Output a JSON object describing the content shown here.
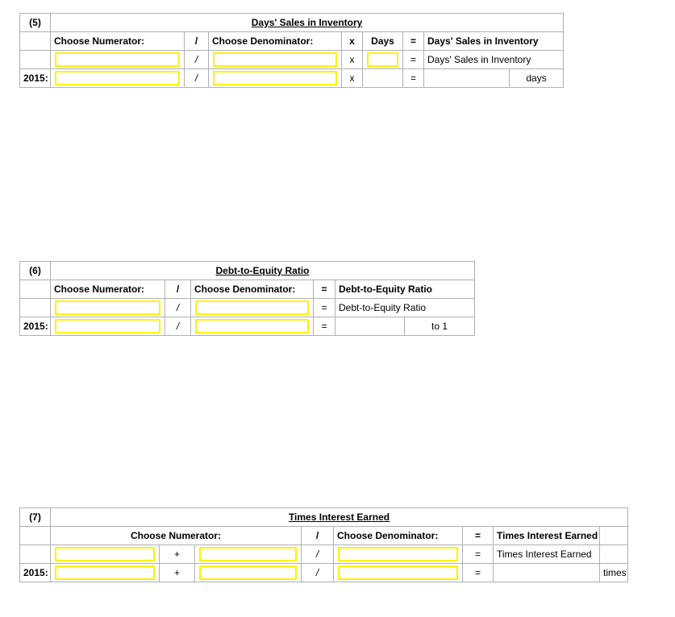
{
  "colors": {
    "header_blue": "#8ca9d9",
    "input_yellow": "#fff200",
    "gridline": "#b0b0b0",
    "text": "#1a1a1a"
  },
  "labels": {
    "choose_numerator": "Choose Numerator:",
    "choose_denominator": "Choose Denominator:",
    "year": "2015:",
    "slash": "/",
    "times": "x",
    "equals": "=",
    "plus": "+"
  },
  "tables": [
    {
      "index": "(5)",
      "title": "Days' Sales in Inventory",
      "headers": {
        "numerator": "Choose Numerator:",
        "op1": "/",
        "denominator": "Choose Denominator:",
        "op2": "x",
        "days": "Days",
        "op3": "=",
        "result": "Days' Sales in Inventory"
      },
      "row1": {
        "label": "",
        "numerator": "",
        "op1": "/",
        "denominator": "",
        "op2": "x",
        "days": "",
        "op3": "=",
        "result": "Days' Sales in Inventory"
      },
      "row2": {
        "label": "2015:",
        "numerator": "",
        "op1": "/",
        "denominator": "",
        "op2": "x",
        "days": "",
        "op3": "=",
        "result_value": "",
        "result_unit": "days"
      }
    },
    {
      "index": "(6)",
      "title": "Debt-to-Equity Ratio",
      "headers": {
        "numerator": "Choose Numerator:",
        "op1": "/",
        "denominator": "Choose Denominator:",
        "op2": "=",
        "result": "Debt-to-Equity Ratio"
      },
      "row1": {
        "label": "",
        "numerator": "",
        "op1": "/",
        "denominator": "",
        "op2": "=",
        "result": "Debt-to-Equity Ratio"
      },
      "row2": {
        "label": "2015:",
        "numerator": "",
        "op1": "/",
        "denominator": "",
        "op2": "=",
        "result_value": "",
        "result_unit": "to 1"
      }
    },
    {
      "index": "(7)",
      "title": "Times Interest Earned",
      "headers": {
        "numerator": "Choose Numerator:",
        "op1": "/",
        "denominator": "Choose Denominator:",
        "op2": "=",
        "result": "Times Interest Earned",
        "unit": ""
      },
      "row1": {
        "label": "",
        "numerator_a": "",
        "plus": "+",
        "numerator_b": "",
        "op1": "/",
        "denominator": "",
        "op2": "=",
        "result": "Times Interest Earned",
        "unit": ""
      },
      "row2": {
        "label": "2015:",
        "numerator_a": "",
        "plus": "+",
        "numerator_b": "",
        "op1": "/",
        "denominator": "",
        "op2": "=",
        "result_value": "",
        "unit": "times"
      }
    }
  ]
}
